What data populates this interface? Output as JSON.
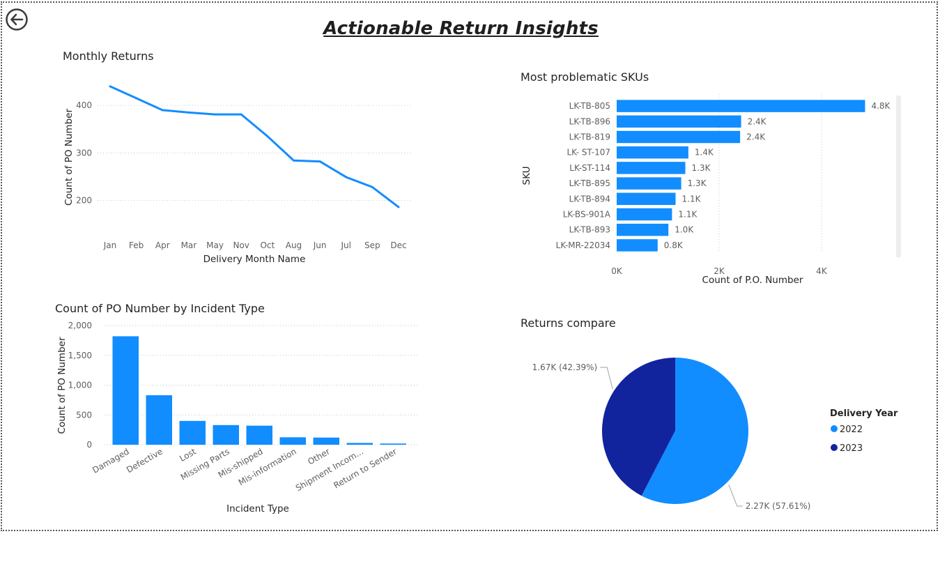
{
  "title": "Actionable Return Insights",
  "colors": {
    "primary": "#118dff",
    "dark": "#12239e",
    "grid": "#c8c6c4"
  },
  "charts": {
    "monthly": {
      "title": "Monthly Returns"
    },
    "skus": {
      "title": "Most problematic SKUs"
    },
    "incident": {
      "title": "Count of PO Number by Incident Type"
    },
    "compare": {
      "title": "Returns compare"
    }
  },
  "chart_data": [
    {
      "type": "line",
      "title": "Monthly Returns",
      "xlabel": "Delivery Month Name",
      "ylabel": "Count of PO Number",
      "categories": [
        "Jan",
        "Feb",
        "Apr",
        "Mar",
        "May",
        "Nov",
        "Oct",
        "Aug",
        "Jun",
        "Jul",
        "Sep",
        "Dec"
      ],
      "values": [
        440,
        415,
        390,
        385,
        381,
        381,
        335,
        284,
        282,
        249,
        228,
        186
      ],
      "yticks": [
        200,
        300,
        400
      ],
      "ytick_labels": [
        "200",
        "300",
        "400"
      ],
      "ylim": [
        145,
        475
      ],
      "grid": true
    },
    {
      "type": "bar",
      "orientation": "horizontal",
      "title": "Most problematic SKUs",
      "xlabel": "Count of P.O. Number",
      "ylabel": "SKU",
      "categories": [
        "LK-TB-805",
        "LK-TB-896",
        "LK-TB-819",
        "LK- ST-107",
        "LK-ST-114",
        "LK-TB-895",
        "LK-TB-894",
        "LK-BS-901A",
        "LK-TB-893",
        "LK-MR-22034"
      ],
      "values": [
        4850,
        2430,
        2410,
        1400,
        1340,
        1260,
        1150,
        1080,
        1010,
        800
      ],
      "data_labels": [
        "4.8K",
        "2.4K",
        "2.4K",
        "1.4K",
        "1.3K",
        "1.3K",
        "1.1K",
        "1.1K",
        "1.0K",
        "0.8K"
      ],
      "xticks": [
        0,
        2000,
        4000
      ],
      "xtick_labels": [
        "0K",
        "2K",
        "4K"
      ],
      "xlim": [
        0,
        5000
      ],
      "grid": true
    },
    {
      "type": "bar",
      "title": "Count of PO Number by Incident Type",
      "xlabel": "Incident Type",
      "ylabel": "Count of PO Number",
      "categories": [
        "Damaged",
        "Defective",
        "Lost",
        "Missing Parts",
        "Mis-shipped",
        "Mis-information",
        "Other",
        "Shipment Incom...",
        "Return to Sender"
      ],
      "values": [
        1820,
        830,
        400,
        330,
        320,
        125,
        120,
        30,
        20
      ],
      "yticks": [
        0,
        500,
        1000,
        1500,
        2000
      ],
      "ytick_labels": [
        "0",
        "500",
        "1,000",
        "1,500",
        "2,000"
      ],
      "ylim": [
        0,
        2000
      ],
      "grid": true
    },
    {
      "type": "pie",
      "title": "Returns compare",
      "legend_title": "Delivery Year",
      "categories": [
        "2022",
        "2023"
      ],
      "values": [
        2270,
        1670
      ],
      "data_labels": [
        "2.27K (57.61%)",
        "1.67K (42.39%)"
      ],
      "legend_position": "right"
    }
  ]
}
